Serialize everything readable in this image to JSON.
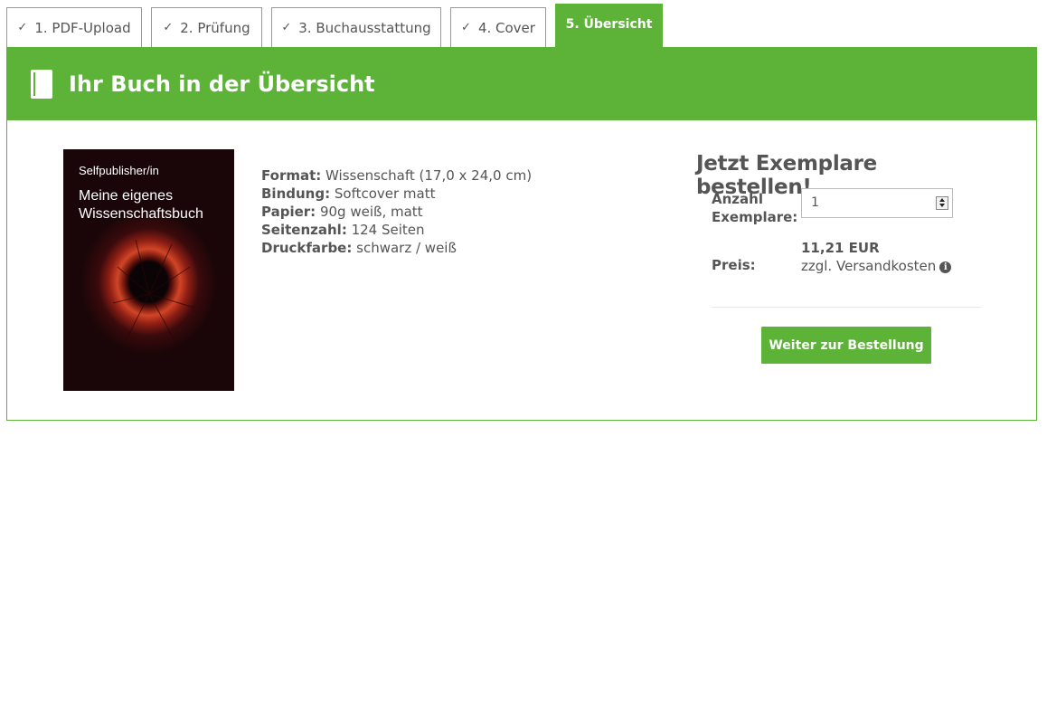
{
  "tabs": [
    {
      "label": "1. PDF-Upload",
      "done": true
    },
    {
      "label": "2. Prüfung",
      "done": true
    },
    {
      "label": "3. Buchausstattung",
      "done": true
    },
    {
      "label": "4. Cover",
      "done": true
    },
    {
      "label": "5. Übersicht",
      "done": false,
      "active": true
    }
  ],
  "check_glyph": "✓",
  "panel": {
    "title": "Ihr Buch in der Übersicht",
    "icon": "book-icon",
    "accent_color": "#5db337"
  },
  "cover": {
    "publisher": "Selfpublisher/in",
    "title_line1": "Meine eigenes",
    "title_line2": "Wissenschaftsbuch"
  },
  "specs": [
    {
      "label": "Format:",
      "value": "Wissenschaft (17,0 x 24,0 cm)"
    },
    {
      "label": "Bindung:",
      "value": "Softcover matt"
    },
    {
      "label": "Papier:",
      "value": "90g weiß, matt"
    },
    {
      "label": "Seitenzahl:",
      "value": "124 Seiten"
    },
    {
      "label": "Druckfarbe:",
      "value": "schwarz / weiß"
    }
  ],
  "order": {
    "title": "Jetzt Exemplare bestellen!",
    "qty_label_line1": "Anzahl",
    "qty_label_line2": "Exemplare:",
    "qty_value": "1",
    "price_label": "Preis:",
    "price_value": "11,21 EUR",
    "shipping": "zzgl. Versandkosten",
    "info_glyph": "i",
    "button": "Weiter zur Bestellung"
  }
}
